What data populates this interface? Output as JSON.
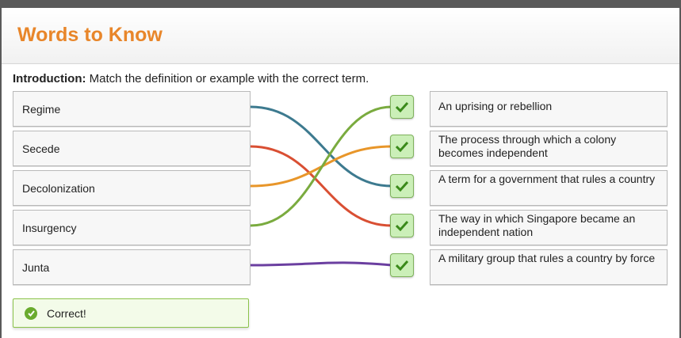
{
  "header": {
    "title": "Words to Know"
  },
  "intro": {
    "label": "Introduction:",
    "text": " Match the definition or example with the correct term."
  },
  "terms": [
    {
      "label": "Regime"
    },
    {
      "label": "Secede"
    },
    {
      "label": "Decolonization"
    },
    {
      "label": "Insurgency"
    },
    {
      "label": "Junta"
    }
  ],
  "definitions": [
    {
      "text": "An uprising or rebellion"
    },
    {
      "text": "The process through which a colony becomes independent"
    },
    {
      "text": "A term for a government that rules a country"
    },
    {
      "text": "The way in which Singapore became an independent nation"
    },
    {
      "text": "A military group that rules a country by force"
    }
  ],
  "matches": [
    {
      "term": "Regime",
      "definition": "A term for a government that rules a country",
      "color": "#3d7a8f",
      "status": "correct"
    },
    {
      "term": "Secede",
      "definition": "The way in which Singapore became an independent nation",
      "color": "#d94f33",
      "status": "correct"
    },
    {
      "term": "Decolonization",
      "definition": "The process through which a colony becomes independent",
      "color": "#e8962a",
      "status": "correct"
    },
    {
      "term": "Insurgency",
      "definition": "An uprising or rebellion",
      "color": "#7aab3f",
      "status": "correct"
    },
    {
      "term": "Junta",
      "definition": "A military group that rules a country by force",
      "color": "#6b3fa0",
      "status": "correct"
    }
  ],
  "check_icon": "check-icon",
  "feedback": {
    "text": "Correct!",
    "icon": "check-circle-icon"
  }
}
